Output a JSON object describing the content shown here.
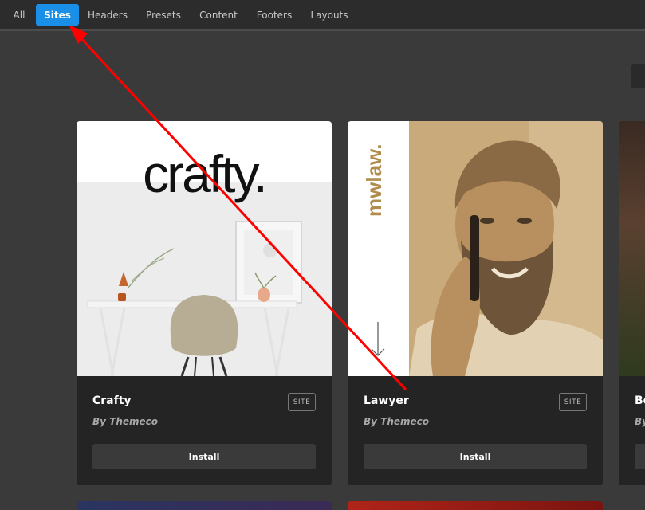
{
  "tabs": [
    {
      "label": "All",
      "active": false
    },
    {
      "label": "Sites",
      "active": true
    },
    {
      "label": "Headers",
      "active": false
    },
    {
      "label": "Presets",
      "active": false
    },
    {
      "label": "Content",
      "active": false
    },
    {
      "label": "Footers",
      "active": false
    },
    {
      "label": "Layouts",
      "active": false
    }
  ],
  "cards": [
    {
      "title": "Crafty",
      "author": "By Themeco",
      "badge": "SITE",
      "install_label": "Install",
      "thumb_text": "crafty."
    },
    {
      "title": "Lawyer",
      "author": "By Themeco",
      "badge": "SITE",
      "install_label": "Install",
      "thumb_text": "mwlaw."
    }
  ],
  "partial_card": {
    "title": "Be",
    "author": "By"
  },
  "colors": {
    "accent": "#1a8fe8",
    "annotation_arrow": "#ff0000",
    "background": "#3a3a3a",
    "card": "#242424"
  }
}
